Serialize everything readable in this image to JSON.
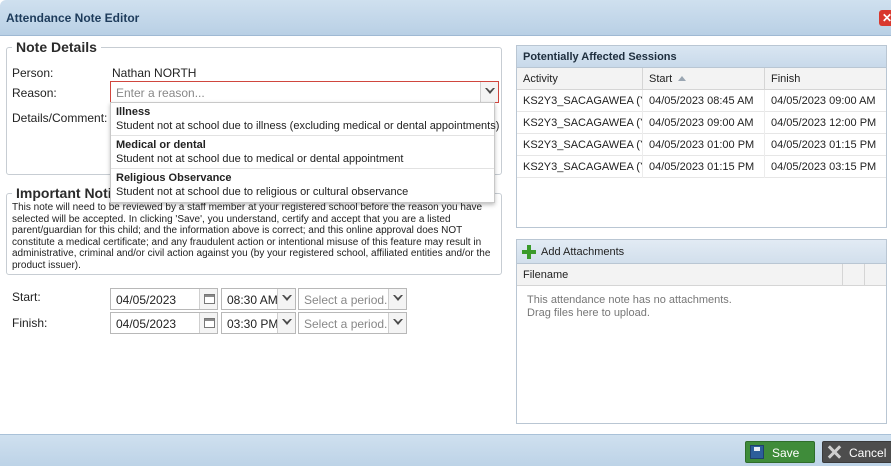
{
  "window": {
    "title": "Attendance Note Editor",
    "close_symbol": "✕"
  },
  "note_details": {
    "legend": "Note Details",
    "person_label": "Person:",
    "person_value": "Nathan NORTH",
    "reason_label": "Reason:",
    "reason_placeholder": "Enter a reason...",
    "details_label": "Details/Comment:"
  },
  "reason_options": [
    {
      "title": "Illness",
      "desc": "Student not at school due to illness (excluding medical or dental appointments)"
    },
    {
      "title": "Medical or dental",
      "desc": "Student not at school due to medical or dental appointment"
    },
    {
      "title": "Religious Observance",
      "desc": "Student not at school due to religious or cultural observance"
    }
  ],
  "important_notice": {
    "legend": "Important Notice",
    "text": "This note will need to be reviewed by a staff member at your registered school before the reason you have selected will be accepted. In clicking 'Save', you understand, certify and accept that you are a listed parent/guardian for this child; and the information above is correct; and this online approval does NOT constitute a medical certificate; and any fraudulent action or intentional misuse of this feature may result in administrative, criminal and/or civil action against you (by your registered school, affiliated entities and/or the product issuer)."
  },
  "schedule": {
    "start_label": "Start:",
    "start_date": "04/05/2023",
    "start_time": "08:30 AM",
    "start_period_placeholder": "Select a period...",
    "finish_label": "Finish:",
    "finish_date": "04/05/2023",
    "finish_time": "03:30 PM",
    "finish_period_placeholder": "Select a period..."
  },
  "sessions": {
    "title": "Potentially Affected Sessions",
    "columns": [
      "Activity",
      "Start",
      "Finish"
    ],
    "rows": [
      [
        "KS2Y3_SACAGAWEA (Y...",
        "04/05/2023 08:45 AM",
        "04/05/2023 09:00 AM"
      ],
      [
        "KS2Y3_SACAGAWEA (Y...",
        "04/05/2023 09:00 AM",
        "04/05/2023 12:00 PM"
      ],
      [
        "KS2Y3_SACAGAWEA (Y...",
        "04/05/2023 01:00 PM",
        "04/05/2023 01:15 PM"
      ],
      [
        "KS2Y3_SACAGAWEA (Y...",
        "04/05/2023 01:15 PM",
        "04/05/2023 03:15 PM"
      ]
    ]
  },
  "attachments": {
    "add_label": "Add Attachments",
    "column": "Filename",
    "empty_line1": "This attendance note has no attachments.",
    "empty_line2": "Drag files here to upload."
  },
  "footer": {
    "save_label": "Save",
    "cancel_label": "Cancel"
  },
  "colors": {
    "accent": "#c8d9ea",
    "save": "#3f8c3a",
    "cancel": "#4d4d4d",
    "error_border": "#d0463e"
  }
}
